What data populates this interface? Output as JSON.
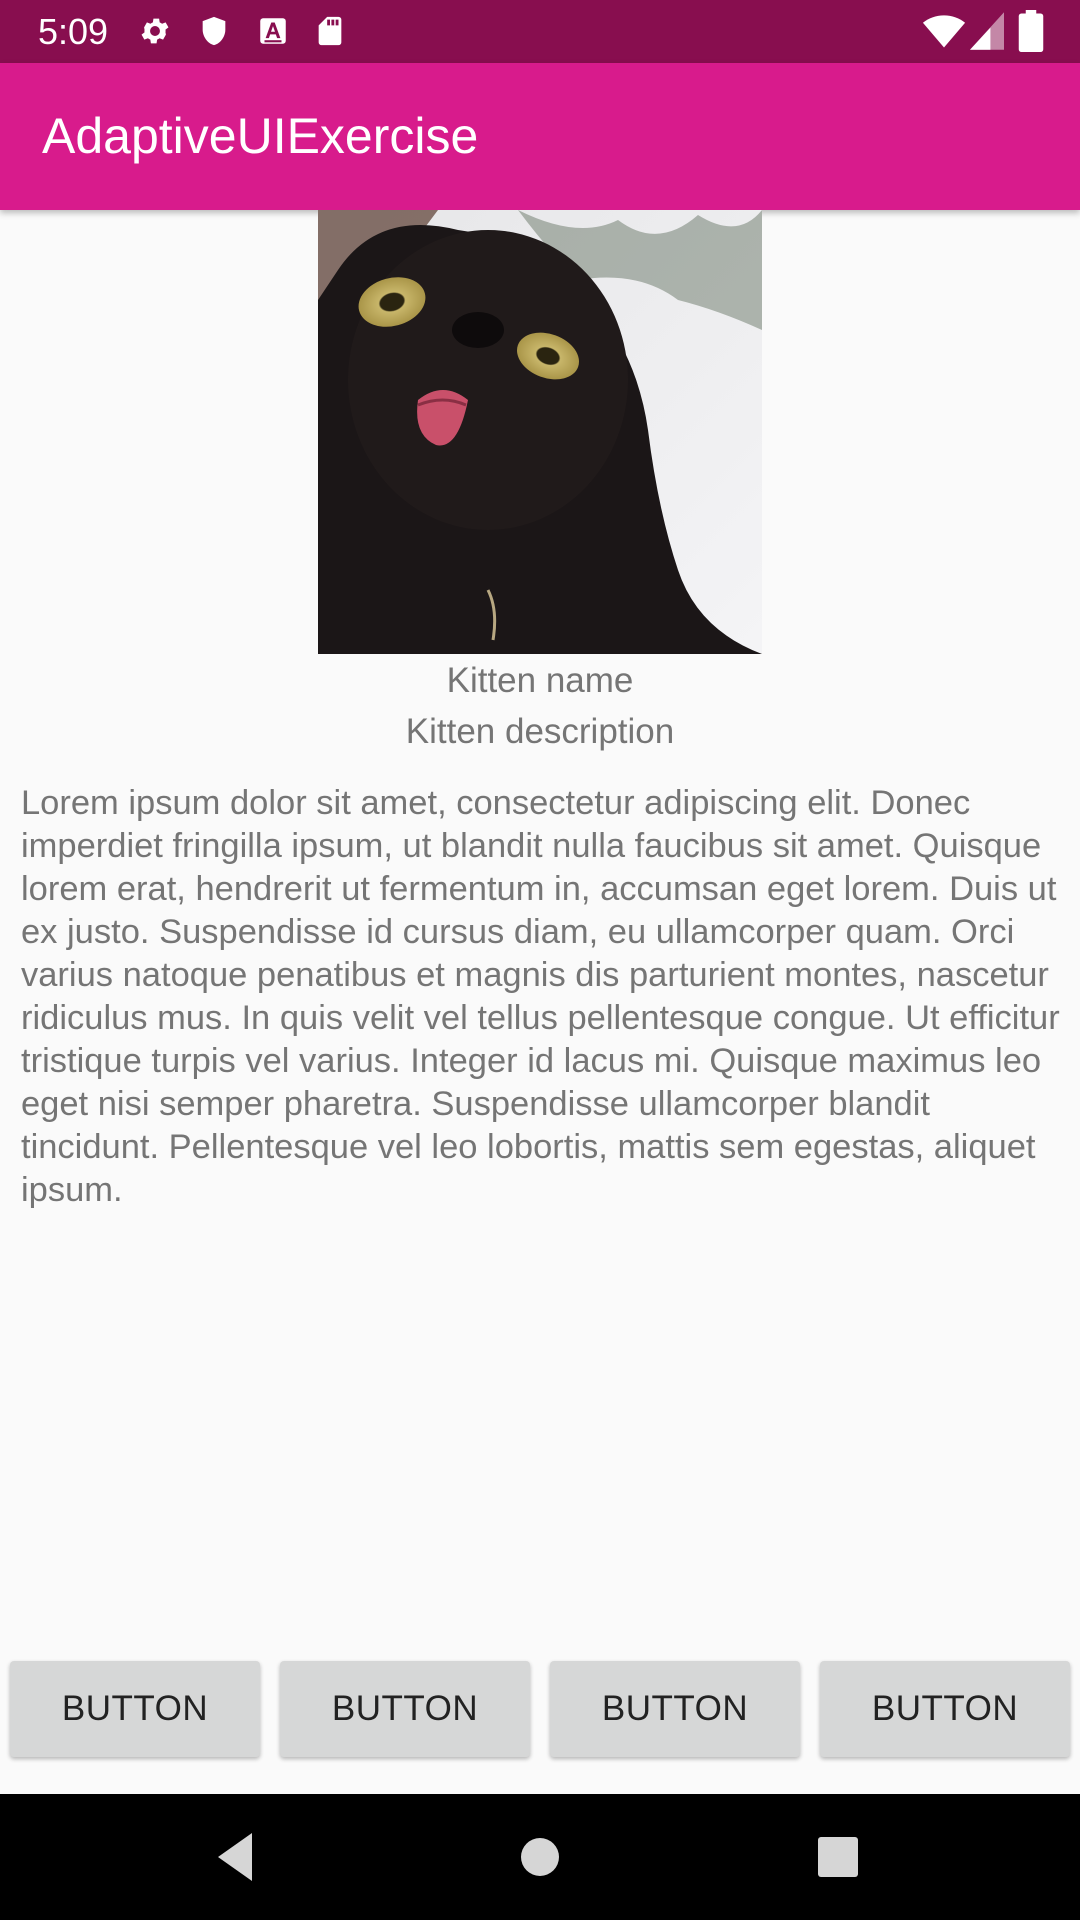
{
  "status_bar": {
    "time": "5:09",
    "left_icons": [
      "gear-icon",
      "shield-icon",
      "a-box-icon",
      "sd-card-icon"
    ],
    "right_icons": [
      "wifi-icon",
      "signal-icon",
      "battery-icon"
    ]
  },
  "app_bar": {
    "title": "AdaptiveUIExercise",
    "color": "#d81b8c"
  },
  "kitten": {
    "name": "Kitten name",
    "description": "Kitten description"
  },
  "body_text": "Lorem ipsum dolor sit amet, consectetur adipiscing elit. Donec imperdiet fringilla ipsum, ut blandit nulla faucibus sit amet. Quisque lorem erat, hendrerit ut fermentum in, accumsan eget lorem. Duis ut ex justo. Suspendisse id cursus diam, eu ullamcorper quam. Orci varius natoque penatibus et magnis dis parturient montes, nascetur ridiculus mus. In quis velit vel tellus pellentesque congue. Ut efficitur tristique turpis vel varius. Integer id lacus mi. Quisque maximus leo eget nisi semper pharetra. Suspendisse ullamcorper blandit tincidunt. Pellentesque vel leo lobortis, mattis sem egestas, aliquet ipsum.",
  "buttons": [
    {
      "label": "BUTTON"
    },
    {
      "label": "BUTTON"
    },
    {
      "label": "BUTTON"
    },
    {
      "label": "BUTTON"
    }
  ],
  "nav_bar": {
    "icons": [
      "back-icon",
      "home-icon",
      "recents-icon"
    ]
  },
  "colors": {
    "status_bar": "#880e4f",
    "app_bar": "#d81b8c",
    "background": "#fafafa",
    "text_secondary": "#757575",
    "button": "#d6d7d7"
  }
}
